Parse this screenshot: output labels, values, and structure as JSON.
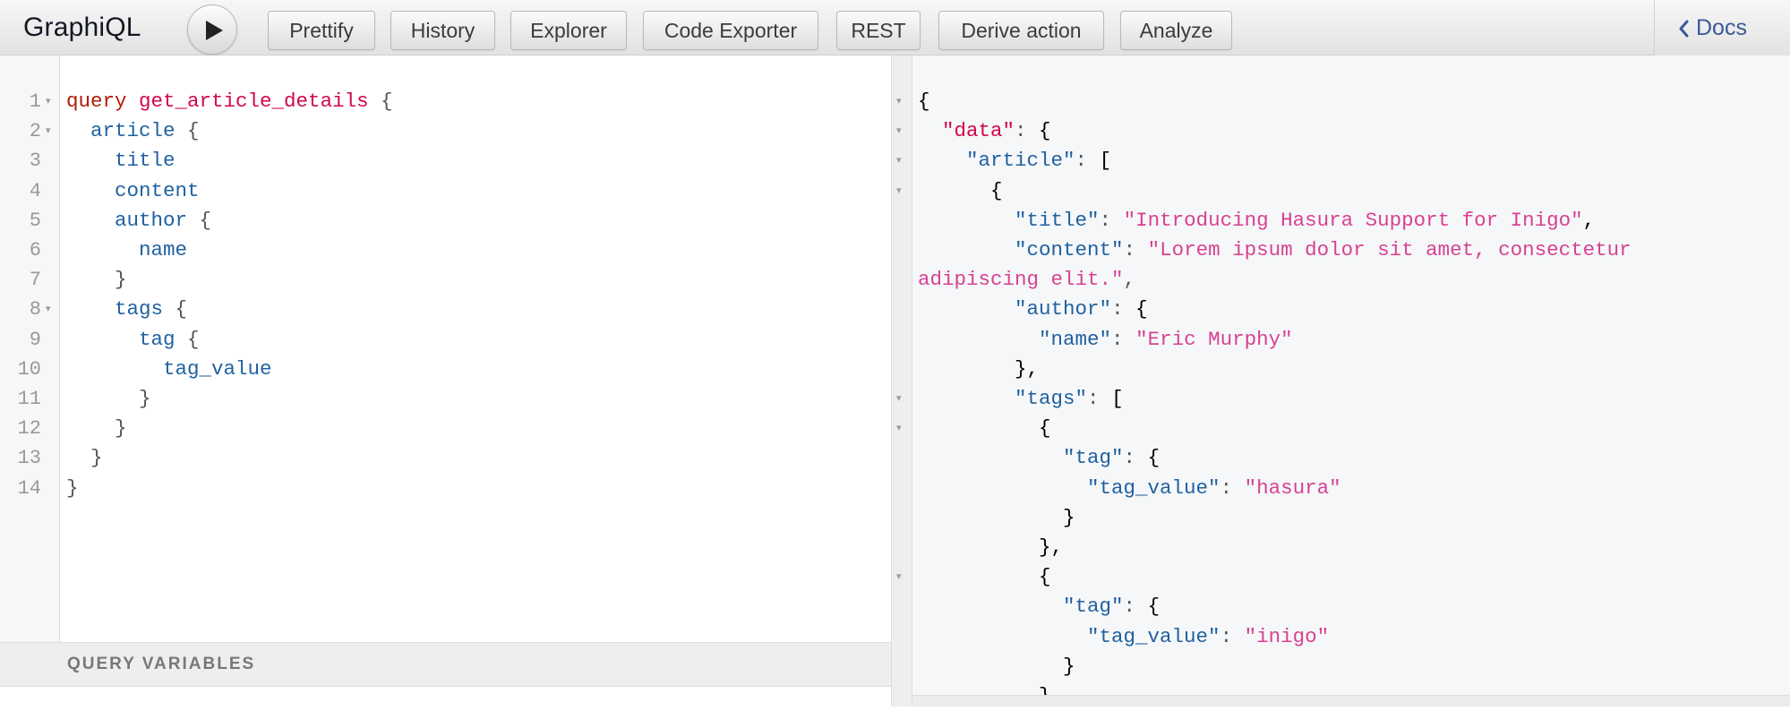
{
  "toolbar": {
    "app_title": "GraphiQL",
    "buttons": [
      "Prettify",
      "History",
      "Explorer",
      "Code Exporter",
      "REST",
      "Derive action",
      "Analyze"
    ],
    "docs_label": "Docs",
    "docs_icon": "chevron-left-icon",
    "run_icon": "play-icon"
  },
  "query_editor": {
    "line_numbers": [
      "1",
      "2",
      "3",
      "4",
      "5",
      "6",
      "7",
      "8",
      "9",
      "10",
      "11",
      "12",
      "13",
      "14"
    ],
    "lines": [
      "query get_article_details {",
      "  article {",
      "    title",
      "    content",
      "    author {",
      "      name",
      "    }",
      "    tags {",
      "      tag {",
      "        tag_value",
      "      }",
      "    }",
      "  }",
      "}"
    ]
  },
  "query_variables": {
    "title": "QUERY VARIABLES"
  },
  "result": {
    "lines": [
      "{",
      "  \"data\": {",
      "    \"article\": [",
      "      {",
      "        \"title\": \"Introducing Hasura Support for Inigo\",",
      "        \"content\": \"Lorem ipsum dolor sit amet, consectetur",
      "adipiscing elit.\",",
      "        \"author\": {",
      "          \"name\": \"Eric Murphy\"",
      "        },",
      "        \"tags\": [",
      "          {",
      "            \"tag\": {",
      "              \"tag_value\": \"hasura\"",
      "            }",
      "          },",
      "          {",
      "            \"tag\": {",
      "              \"tag_value\": \"inigo\"",
      "            }",
      "          }"
    ]
  },
  "colors": {
    "keyword": "#b11a04",
    "def": "#d2054e",
    "field": "#1f61a0",
    "string": "#d64292",
    "docs_link": "#3b5998"
  }
}
